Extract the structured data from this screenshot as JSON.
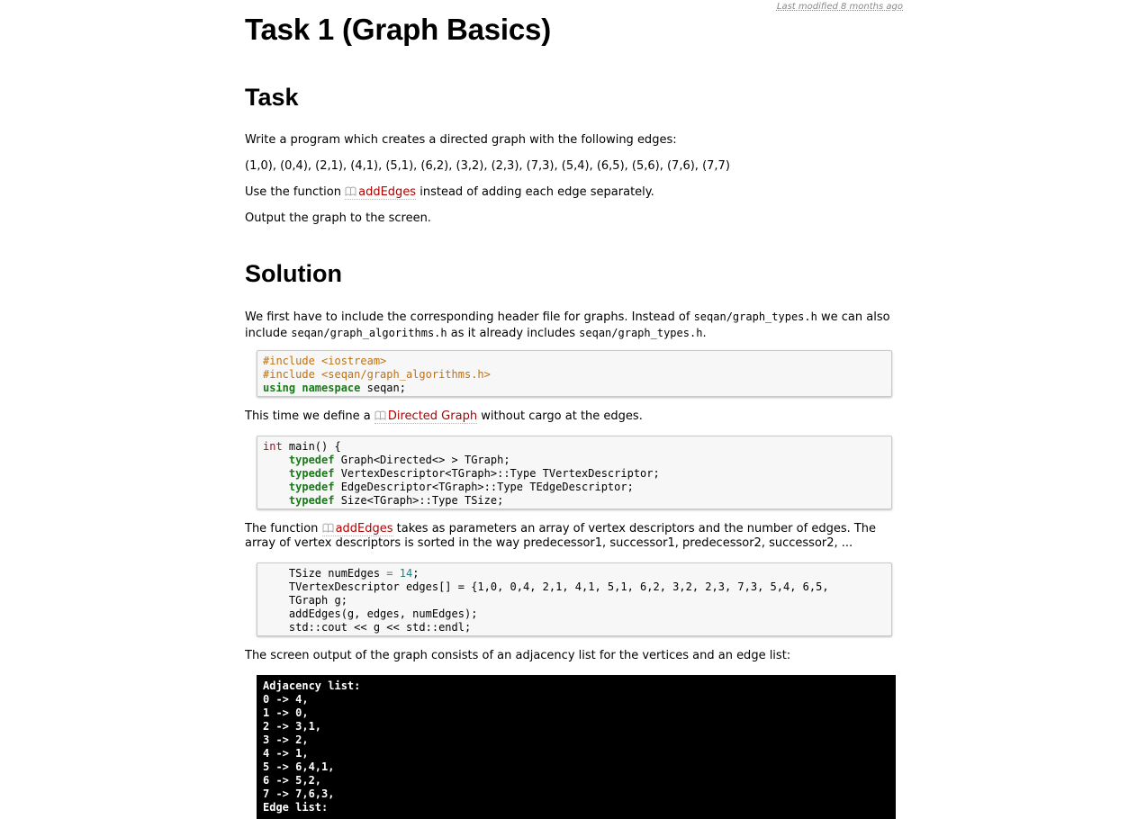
{
  "meta": {
    "last_modified_prefix": "Last modified ",
    "last_modified_link": "8 months ago"
  },
  "page_title": "Task 1 (Graph Basics)",
  "task": {
    "heading": "Task",
    "p1": "Write a program which creates a directed graph with the following edges:",
    "edges_line": "(1,0), (0,4), (2,1), (4,1), (5,1), (6,2), (3,2), (2,3), (7,3), (5,4), (6,5), (5,6), (7,6), (7,7)",
    "p3_before": "Use the function ",
    "p3_link": "addEdges",
    "p3_after": " instead of adding each edge separately.",
    "p4": "Output the graph to the screen."
  },
  "solution": {
    "heading": "Solution",
    "p1_a": "We first have to include the corresponding header file for graphs. Instead of ",
    "p1_code1": "seqan/graph_types.h",
    "p1_b": " we can also include ",
    "p1_code2": "seqan/graph_algorithms.h",
    "p1_c": " as it already includes ",
    "p1_code3": "seqan/graph_types.h",
    "p1_d": ".",
    "p2_before": "This time we define a ",
    "p2_link": "Directed Graph",
    "p2_after": " without cargo at the edges.",
    "p3_before": "The function ",
    "p3_link": "addEdges",
    "p3_after": " takes as parameters an array of vertex descriptors and the number of edges. The array of vertex descriptors is sorted in the way predecessor1, successor1, predecessor2, successor2, ...",
    "p4": "The screen output of the graph consists of an adjacency list for the vertices and an edge list:"
  },
  "code1": {
    "include1": "#include <iostream>",
    "include2": "#include <seqan/graph_algorithms.h>",
    "kw_using": "using",
    "kw_namespace": "namespace",
    "ns_rest": " seqan;"
  },
  "code2": {
    "line1_type": "int",
    "line1_rest": " main() {",
    "typedef_kw": "typedef",
    "line2_rest": " Graph<Directed<> > TGraph;",
    "line3_rest": " VertexDescriptor<TGraph>::Type TVertexDescriptor;",
    "line4_rest": " EdgeDescriptor<TGraph>::Type TEdgeDescriptor;",
    "line5_rest": " Size<TGraph>::Type TSize;"
  },
  "code3": {
    "line1_a": "    TSize numEdges ",
    "line1_op": "=",
    "line1_num": " 14",
    "line1_end": ";",
    "line2": "    TVertexDescriptor edges[] = {1,0, 0,4, 2,1, 4,1, 5,1, 6,2, 3,2, 2,3, 7,3, 5,4, 6,5,",
    "line3": "    TGraph g;",
    "line4": "    addEdges(g, edges, numEdges);",
    "line5": "    std::cout << g << std::endl;"
  },
  "console_output": {
    "lines": [
      "Adjacency list:",
      "0 -> 4,",
      "1 -> 0,",
      "2 -> 3,1,",
      "3 -> 2,",
      "4 -> 1,",
      "5 -> 6,4,1,",
      "6 -> 5,2,",
      "7 -> 7,6,3,",
      "Edge list:"
    ]
  },
  "colors": {
    "link": "#b00000",
    "preprocessor": "#c07010",
    "keyword": "#1a7a1a",
    "type": "#a01020",
    "number": "#208080"
  },
  "icons": {
    "wiki_link": "book-icon"
  }
}
